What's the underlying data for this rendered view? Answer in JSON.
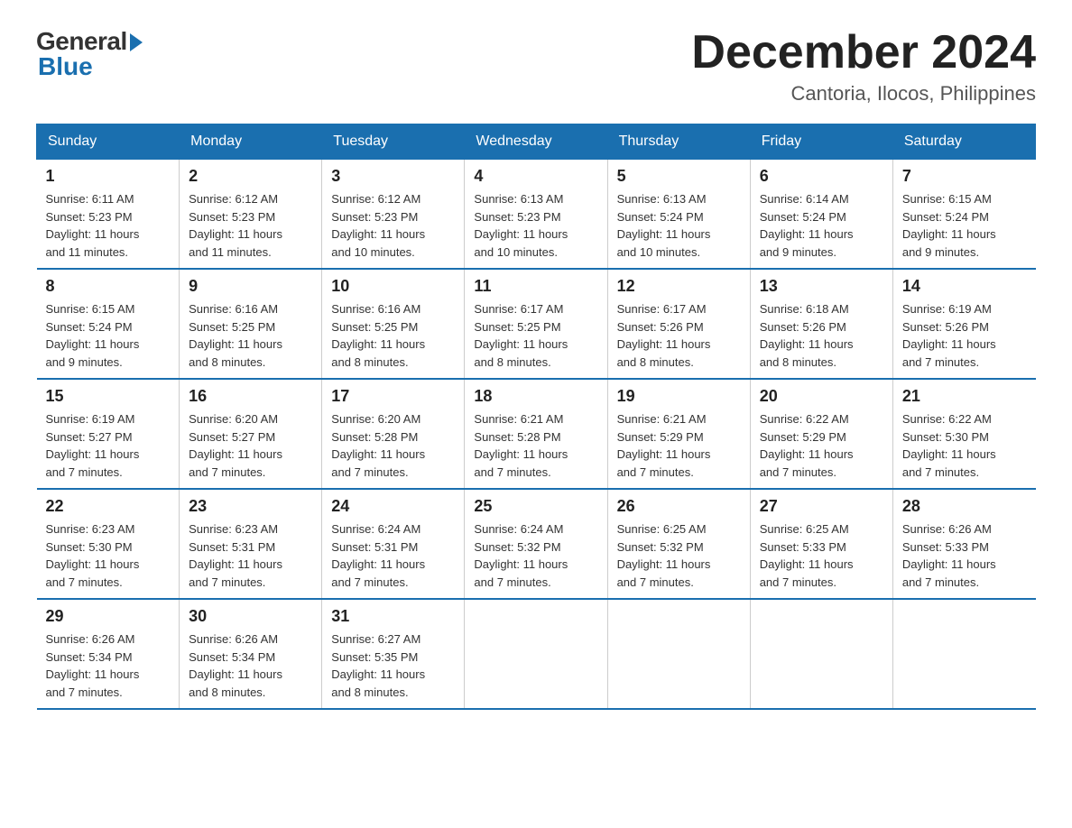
{
  "logo": {
    "general": "General",
    "blue": "Blue"
  },
  "title": {
    "month": "December 2024",
    "location": "Cantoria, Ilocos, Philippines"
  },
  "weekdays": [
    "Sunday",
    "Monday",
    "Tuesday",
    "Wednesday",
    "Thursday",
    "Friday",
    "Saturday"
  ],
  "weeks": [
    [
      {
        "day": "1",
        "sunrise": "6:11 AM",
        "sunset": "5:23 PM",
        "daylight": "11 hours and 11 minutes."
      },
      {
        "day": "2",
        "sunrise": "6:12 AM",
        "sunset": "5:23 PM",
        "daylight": "11 hours and 11 minutes."
      },
      {
        "day": "3",
        "sunrise": "6:12 AM",
        "sunset": "5:23 PM",
        "daylight": "11 hours and 10 minutes."
      },
      {
        "day": "4",
        "sunrise": "6:13 AM",
        "sunset": "5:23 PM",
        "daylight": "11 hours and 10 minutes."
      },
      {
        "day": "5",
        "sunrise": "6:13 AM",
        "sunset": "5:24 PM",
        "daylight": "11 hours and 10 minutes."
      },
      {
        "day": "6",
        "sunrise": "6:14 AM",
        "sunset": "5:24 PM",
        "daylight": "11 hours and 9 minutes."
      },
      {
        "day": "7",
        "sunrise": "6:15 AM",
        "sunset": "5:24 PM",
        "daylight": "11 hours and 9 minutes."
      }
    ],
    [
      {
        "day": "8",
        "sunrise": "6:15 AM",
        "sunset": "5:24 PM",
        "daylight": "11 hours and 9 minutes."
      },
      {
        "day": "9",
        "sunrise": "6:16 AM",
        "sunset": "5:25 PM",
        "daylight": "11 hours and 8 minutes."
      },
      {
        "day": "10",
        "sunrise": "6:16 AM",
        "sunset": "5:25 PM",
        "daylight": "11 hours and 8 minutes."
      },
      {
        "day": "11",
        "sunrise": "6:17 AM",
        "sunset": "5:25 PM",
        "daylight": "11 hours and 8 minutes."
      },
      {
        "day": "12",
        "sunrise": "6:17 AM",
        "sunset": "5:26 PM",
        "daylight": "11 hours and 8 minutes."
      },
      {
        "day": "13",
        "sunrise": "6:18 AM",
        "sunset": "5:26 PM",
        "daylight": "11 hours and 8 minutes."
      },
      {
        "day": "14",
        "sunrise": "6:19 AM",
        "sunset": "5:26 PM",
        "daylight": "11 hours and 7 minutes."
      }
    ],
    [
      {
        "day": "15",
        "sunrise": "6:19 AM",
        "sunset": "5:27 PM",
        "daylight": "11 hours and 7 minutes."
      },
      {
        "day": "16",
        "sunrise": "6:20 AM",
        "sunset": "5:27 PM",
        "daylight": "11 hours and 7 minutes."
      },
      {
        "day": "17",
        "sunrise": "6:20 AM",
        "sunset": "5:28 PM",
        "daylight": "11 hours and 7 minutes."
      },
      {
        "day": "18",
        "sunrise": "6:21 AM",
        "sunset": "5:28 PM",
        "daylight": "11 hours and 7 minutes."
      },
      {
        "day": "19",
        "sunrise": "6:21 AM",
        "sunset": "5:29 PM",
        "daylight": "11 hours and 7 minutes."
      },
      {
        "day": "20",
        "sunrise": "6:22 AM",
        "sunset": "5:29 PM",
        "daylight": "11 hours and 7 minutes."
      },
      {
        "day": "21",
        "sunrise": "6:22 AM",
        "sunset": "5:30 PM",
        "daylight": "11 hours and 7 minutes."
      }
    ],
    [
      {
        "day": "22",
        "sunrise": "6:23 AM",
        "sunset": "5:30 PM",
        "daylight": "11 hours and 7 minutes."
      },
      {
        "day": "23",
        "sunrise": "6:23 AM",
        "sunset": "5:31 PM",
        "daylight": "11 hours and 7 minutes."
      },
      {
        "day": "24",
        "sunrise": "6:24 AM",
        "sunset": "5:31 PM",
        "daylight": "11 hours and 7 minutes."
      },
      {
        "day": "25",
        "sunrise": "6:24 AM",
        "sunset": "5:32 PM",
        "daylight": "11 hours and 7 minutes."
      },
      {
        "day": "26",
        "sunrise": "6:25 AM",
        "sunset": "5:32 PM",
        "daylight": "11 hours and 7 minutes."
      },
      {
        "day": "27",
        "sunrise": "6:25 AM",
        "sunset": "5:33 PM",
        "daylight": "11 hours and 7 minutes."
      },
      {
        "day": "28",
        "sunrise": "6:26 AM",
        "sunset": "5:33 PM",
        "daylight": "11 hours and 7 minutes."
      }
    ],
    [
      {
        "day": "29",
        "sunrise": "6:26 AM",
        "sunset": "5:34 PM",
        "daylight": "11 hours and 7 minutes."
      },
      {
        "day": "30",
        "sunrise": "6:26 AM",
        "sunset": "5:34 PM",
        "daylight": "11 hours and 8 minutes."
      },
      {
        "day": "31",
        "sunrise": "6:27 AM",
        "sunset": "5:35 PM",
        "daylight": "11 hours and 8 minutes."
      },
      null,
      null,
      null,
      null
    ]
  ],
  "labels": {
    "sunrise": "Sunrise:",
    "sunset": "Sunset:",
    "daylight": "Daylight:"
  }
}
